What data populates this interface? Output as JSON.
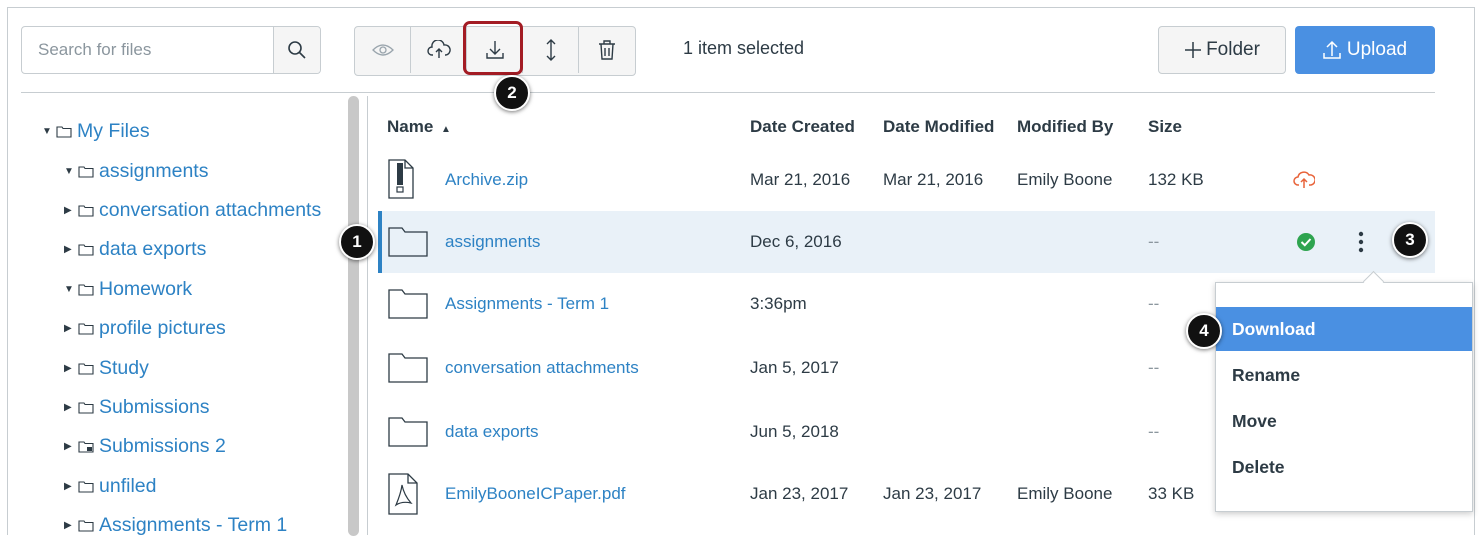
{
  "search": {
    "placeholder": "Search for files"
  },
  "toolbar": {
    "buttons": [
      "preview-icon",
      "cloud-publish-icon",
      "download-icon",
      "move-icon",
      "trash-icon"
    ],
    "selected_text": "1 item selected",
    "folder_label": "Folder",
    "upload_label": "Upload"
  },
  "callouts": [
    "1",
    "2",
    "3",
    "4"
  ],
  "tree": [
    {
      "label": "My Files",
      "expanded": true
    },
    {
      "label": "assignments",
      "expanded": true
    },
    {
      "label": "conversation attachments",
      "expanded": false
    },
    {
      "label": "data exports",
      "expanded": false
    },
    {
      "label": "Homework",
      "expanded": true
    },
    {
      "label": "profile pictures",
      "expanded": false
    },
    {
      "label": "Study",
      "expanded": false
    },
    {
      "label": "Submissions",
      "expanded": false
    },
    {
      "label": "Submissions 2",
      "expanded": false
    },
    {
      "label": "unfiled",
      "expanded": false
    },
    {
      "label": "Assignments - Term 1",
      "expanded": false
    }
  ],
  "table": {
    "headers": {
      "name": "Name",
      "sort_indicator": "▲",
      "date_created": "Date Created",
      "date_modified": "Date Modified",
      "modified_by": "Modified By",
      "size": "Size"
    },
    "rows": [
      {
        "icon": "zip-file-icon",
        "name": "Archive.zip",
        "date_created": "Mar 21, 2016",
        "date_modified": "Mar 21, 2016",
        "modified_by": "Emily Boone",
        "size": "132 KB"
      },
      {
        "icon": "folder-icon",
        "name": "assignments",
        "date_created": "Dec 6, 2016",
        "date_modified": "",
        "modified_by": "",
        "size": "--"
      },
      {
        "icon": "folder-icon",
        "name": "Assignments - Term 1",
        "date_created": "3:36pm",
        "date_modified": "",
        "modified_by": "",
        "size": "--"
      },
      {
        "icon": "folder-icon",
        "name": "conversation attachments",
        "date_created": "Jan 5, 2017",
        "date_modified": "",
        "modified_by": "",
        "size": "--"
      },
      {
        "icon": "folder-icon",
        "name": "data exports",
        "date_created": "Jun 5, 2018",
        "date_modified": "",
        "modified_by": "",
        "size": "--"
      },
      {
        "icon": "pdf-file-icon",
        "name": "EmilyBooneICPaper.pdf",
        "date_created": "Jan 23, 2017",
        "date_modified": "Jan 23, 2017",
        "modified_by": "Emily Boone",
        "size": "33 KB"
      }
    ]
  },
  "menu": {
    "items": [
      "Download",
      "Rename",
      "Move",
      "Delete"
    ],
    "active": "Download"
  },
  "colors": {
    "link": "#2d82c4",
    "primary": "#4a90e2",
    "highlight_border": "#a31c24",
    "published": "#2ea44f",
    "unpublished": "#e8633a"
  }
}
